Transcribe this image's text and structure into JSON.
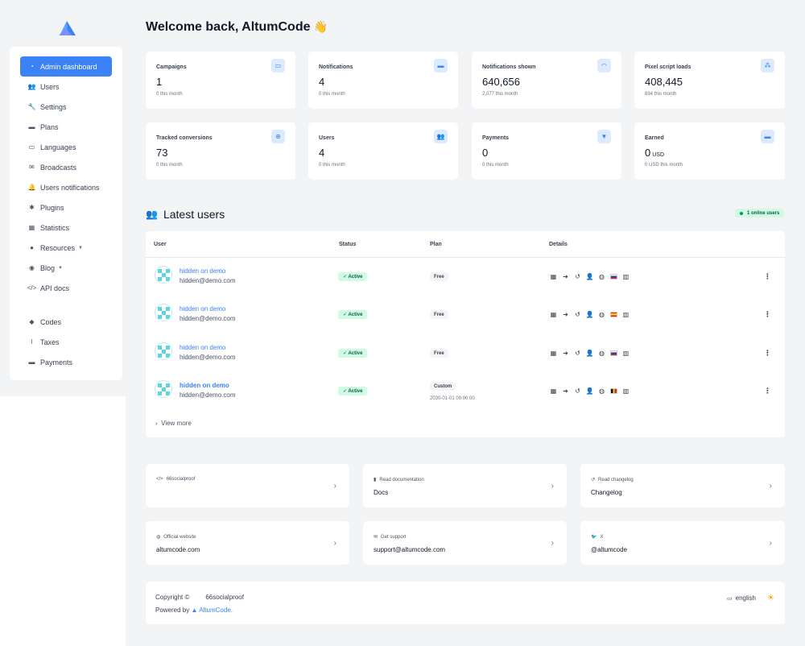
{
  "welcome": {
    "text": "Welcome back, AltumCode",
    "emoji": "👋"
  },
  "sidebar": {
    "items": [
      {
        "label": "Admin dashboard",
        "icon": "gauge-icon"
      },
      {
        "label": "Users",
        "icon": "users-icon"
      },
      {
        "label": "Settings",
        "icon": "wrench-icon"
      },
      {
        "label": "Plans",
        "icon": "box-icon"
      },
      {
        "label": "Languages",
        "icon": "language-icon"
      },
      {
        "label": "Broadcasts",
        "icon": "mail-icon"
      },
      {
        "label": "Users notifications",
        "icon": "bell-icon"
      },
      {
        "label": "Plugins",
        "icon": "puzzle-icon"
      },
      {
        "label": "Statistics",
        "icon": "chart-icon"
      },
      {
        "label": "Resources",
        "icon": "info-icon"
      },
      {
        "label": "Blog",
        "icon": "blog-icon"
      },
      {
        "label": "API docs",
        "icon": "code-icon"
      },
      {
        "label": "Codes",
        "icon": "tag-icon"
      },
      {
        "label": "Taxes",
        "icon": "paperclip-icon"
      },
      {
        "label": "Payments",
        "icon": "credit-card-icon"
      }
    ]
  },
  "stats": [
    {
      "label": "Campaigns",
      "value": "1",
      "unit": "",
      "sub": "0 this month",
      "icon": "window-icon"
    },
    {
      "label": "Notifications",
      "value": "4",
      "unit": "",
      "sub": "0 this month",
      "icon": "window-alt-icon"
    },
    {
      "label": "Notifications shown",
      "value": "640,656",
      "unit": "",
      "sub": "2,077 this month",
      "icon": "wifi-icon"
    },
    {
      "label": "Pixel script loads",
      "value": "408,445",
      "unit": "",
      "sub": "834 this month",
      "icon": "network-icon"
    },
    {
      "label": "Tracked conversions",
      "value": "73",
      "unit": "",
      "sub": "0 this month",
      "icon": "globe-icon"
    },
    {
      "label": "Users",
      "value": "4",
      "unit": "",
      "sub": "0 this month",
      "icon": "users-icon"
    },
    {
      "label": "Payments",
      "value": "0",
      "unit": "",
      "sub": "0 this month",
      "icon": "funnel-icon"
    },
    {
      "label": "Earned",
      "value": "0",
      "unit": "USD",
      "sub": "0 USD this month",
      "icon": "credit-card-icon"
    }
  ],
  "latest_users": {
    "title": "Latest users",
    "online_badge": "1 online users",
    "columns": [
      "User",
      "Status",
      "Plan",
      "Details"
    ],
    "rows": [
      {
        "name": "hidden on demo",
        "email": "hidden@demo.com",
        "status": "✓ Active",
        "plan": "Free",
        "plan_date": "",
        "flag": "ru"
      },
      {
        "name": "hidden on demo",
        "email": "hidden@demo.com",
        "status": "✓ Active",
        "plan": "Free",
        "plan_date": "",
        "flag": "es"
      },
      {
        "name": "hidden on demo",
        "email": "hidden@demo.com",
        "status": "✓ Active",
        "plan": "Free",
        "plan_date": "",
        "flag": "ru"
      },
      {
        "name": "hidden on demo",
        "email": "hidden@demo.com",
        "status": "✓ Active",
        "plan": "Custom",
        "plan_date": "2030-01-01 00:00:00",
        "flag": "be"
      }
    ],
    "view_more": "View more"
  },
  "links": [
    {
      "small": "66socialproof",
      "big": "",
      "icon": "code-icon"
    },
    {
      "small": "Read documentation",
      "big": "Docs",
      "icon": "book-icon"
    },
    {
      "small": "Read changelog",
      "big": "Changelog",
      "icon": "history-icon"
    },
    {
      "small": "Official website",
      "big": "altumcode.com",
      "icon": "globe-icon"
    },
    {
      "small": "Get support",
      "big": "support@altumcode.com",
      "icon": "envelope-icon"
    },
    {
      "small": "X",
      "big": "@altumcode",
      "icon": "twitter-icon"
    }
  ],
  "footer": {
    "copyright": "Copyright ©",
    "brand": "66socialproof",
    "powered_by": "Powered by",
    "powered_link": "AltumCode.",
    "language": "english"
  },
  "colors": {
    "accent": "#3b82f6",
    "success_bg": "#d1fae5",
    "success_text": "#065f46"
  }
}
